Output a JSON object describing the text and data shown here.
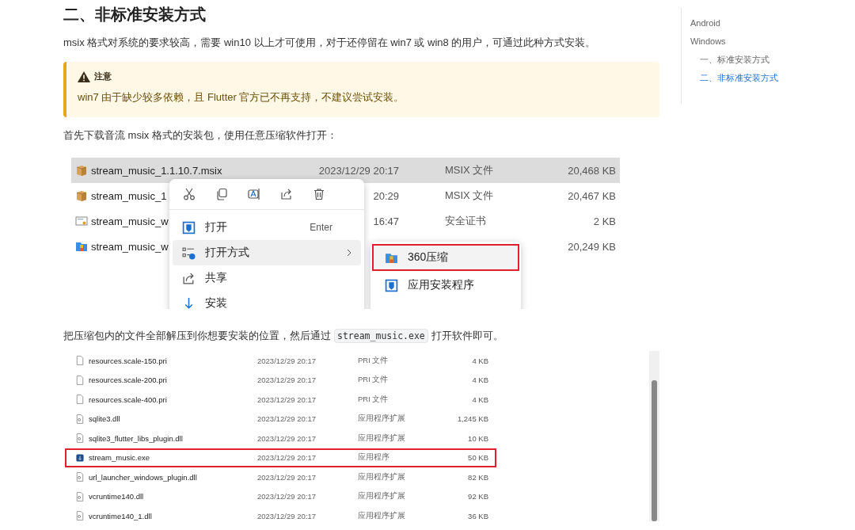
{
  "heading": "二、非标准安装方式",
  "intro": "msix 格式对系统的要求较高，需要 win10 以上才可使用，对于还停留在 win7 或 win8 的用户，可通过此种方式安装。",
  "note": {
    "title": "注意",
    "text": "win7 由于缺少较多依赖，且 Flutter 官方已不再支持，不建议尝试安装。"
  },
  "para_1": "首先下载音流 msix 格式的安装包，使用任意压缩软件打开：",
  "screenshot_1": {
    "files": [
      {
        "kind": "package",
        "name": "stream_music_1.1.10.7.msix",
        "date": "2023/12/29 20:17",
        "type": "MSIX 文件",
        "size": "20,468 KB",
        "selected": true
      },
      {
        "kind": "package",
        "name": "stream_music_1",
        "date": "20:29",
        "type": "MSIX 文件",
        "size": "20,467 KB",
        "selected": false
      },
      {
        "kind": "certificate",
        "name": "stream_music_w",
        "date": "16:47",
        "type": "安全证书",
        "size": "2 KB",
        "selected": false
      },
      {
        "kind": "archive",
        "name": "stream_music_w",
        "size": "20,249 KB",
        "selected": false
      }
    ],
    "menu": [
      {
        "kind": "open",
        "label": "打开",
        "shortcut": "Enter",
        "submenu": false,
        "highlighted": false
      },
      {
        "kind": "open-with",
        "label": "打开方式",
        "submenu": true,
        "highlighted": true
      },
      {
        "kind": "share",
        "label": "共享",
        "submenu": false,
        "highlighted": false
      },
      {
        "kind": "install",
        "label": "安装",
        "submenu": false,
        "highlighted": false
      }
    ],
    "submenu": [
      {
        "kind": "archive",
        "label": "360压缩",
        "outlined": true
      },
      {
        "kind": "open",
        "label": "应用安装程序",
        "outlined": false
      }
    ]
  },
  "para_2": [
    {
      "kind": "text",
      "text": "把压缩包内的文件全部解压到你想要安装的位置，然后通过"
    },
    {
      "kind": "code",
      "text": "stream_music.exe"
    },
    {
      "kind": "text",
      "text": "打开软件即可。"
    }
  ],
  "screenshot_2": {
    "files": [
      {
        "kind": "file",
        "name": "resources.scale-150.pri",
        "date": "2023/12/29 20:17",
        "type": "PRI 文件",
        "size": "4 KB",
        "outlined": false
      },
      {
        "kind": "file",
        "name": "resources.scale-200.pri",
        "date": "2023/12/29 20:17",
        "type": "PRI 文件",
        "size": "4 KB",
        "outlined": false
      },
      {
        "kind": "file",
        "name": "resources.scale-400.pri",
        "date": "2023/12/29 20:17",
        "type": "PRI 文件",
        "size": "4 KB",
        "outlined": false
      },
      {
        "kind": "dll",
        "name": "sqlite3.dll",
        "date": "2023/12/29 20:17",
        "type": "应用程序扩展",
        "size": "1,245 KB",
        "outlined": false
      },
      {
        "kind": "dll",
        "name": "sqlite3_flutter_libs_plugin.dll",
        "date": "2023/12/29 20:17",
        "type": "应用程序扩展",
        "size": "10 KB",
        "outlined": false
      },
      {
        "kind": "exe",
        "name": "stream_music.exe",
        "date": "2023/12/29 20:17",
        "type": "应用程序",
        "size": "50 KB",
        "outlined": true
      },
      {
        "kind": "dll",
        "name": "url_launcher_windows_plugin.dll",
        "date": "2023/12/29 20:17",
        "type": "应用程序扩展",
        "size": "82 KB",
        "outlined": false
      },
      {
        "kind": "dll",
        "name": "vcruntime140.dll",
        "date": "2023/12/29 20:17",
        "type": "应用程序扩展",
        "size": "92 KB",
        "outlined": false
      },
      {
        "kind": "dll",
        "name": "vcruntime140_1.dll",
        "date": "2023/12/29 20:17",
        "type": "应用程序扩展",
        "size": "36 KB",
        "outlined": false
      }
    ]
  },
  "toc": [
    {
      "label": "Android",
      "selected": false
    },
    {
      "label": "Windows",
      "selected": false,
      "children": [
        {
          "label": "一、标准安装方式",
          "selected": false
        },
        {
          "label": "二、非标准安装方式",
          "selected": true
        }
      ]
    }
  ]
}
